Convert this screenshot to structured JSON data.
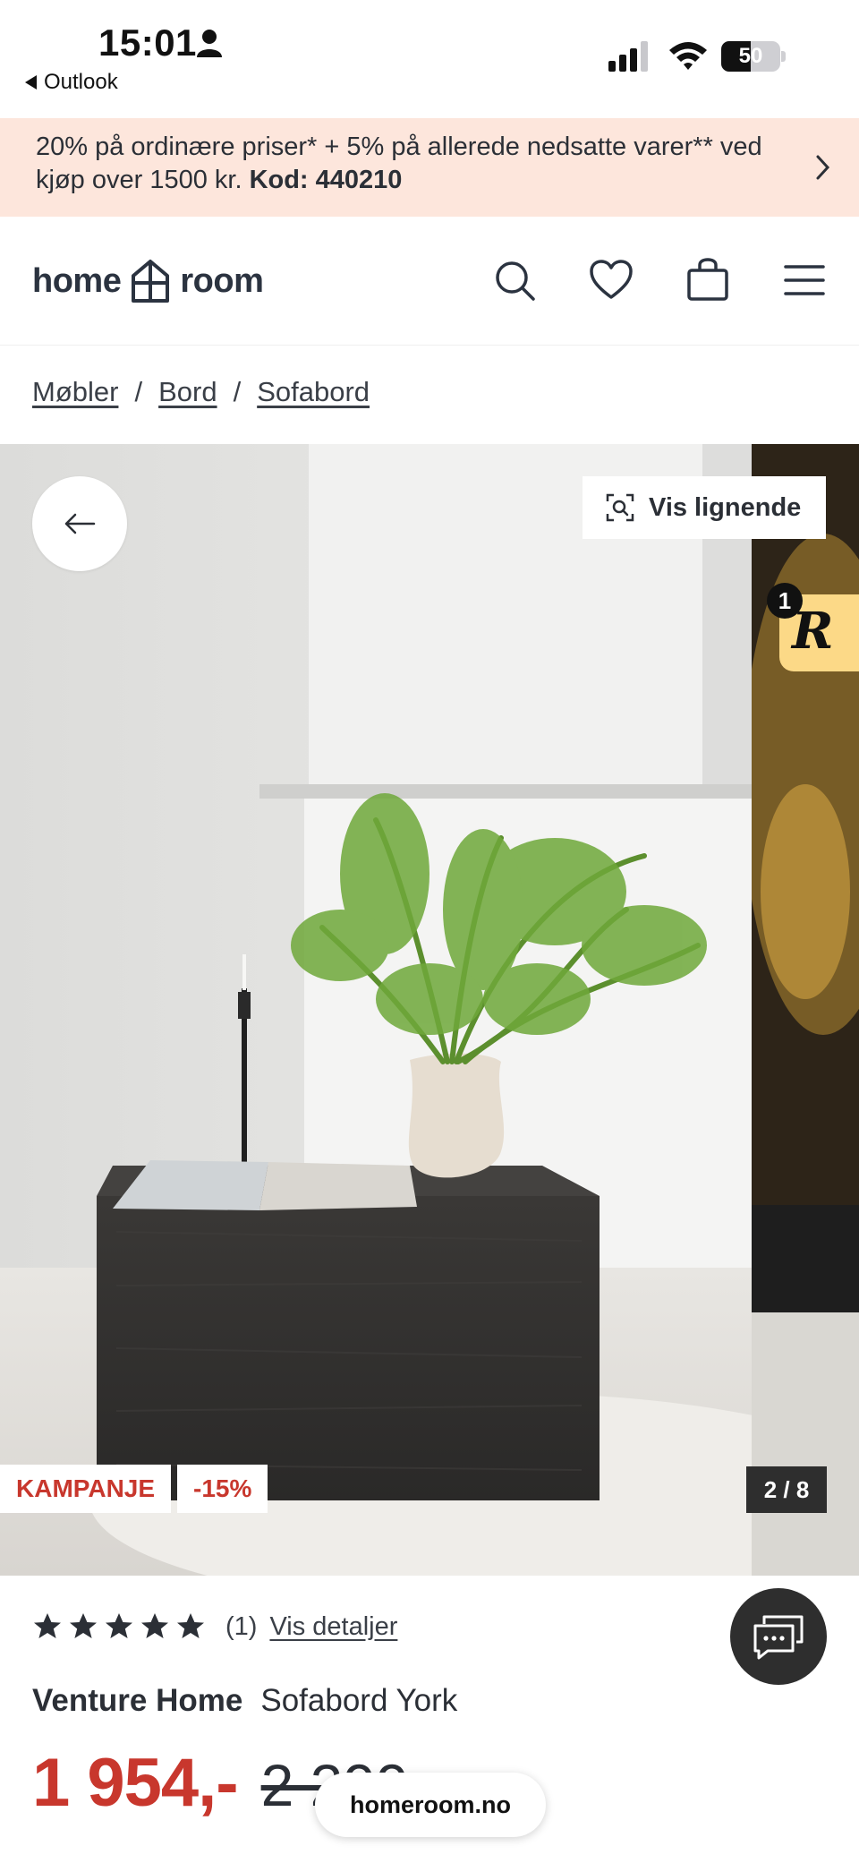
{
  "status_bar": {
    "time": "15:01",
    "back_app": "Outlook",
    "battery_level": "50"
  },
  "promo": {
    "text_line": "20% på ordinære priser* + 5% på allerede nedsatte varer** ved kjøp over 1500 kr.",
    "code": "Kod: 440210"
  },
  "header": {
    "logo_left": "home",
    "logo_right": "room",
    "icons": [
      "search-icon",
      "heart-icon",
      "bag-icon",
      "menu-icon"
    ]
  },
  "breadcrumb": {
    "items": [
      "Møbler",
      "Bord",
      "Sofabord"
    ],
    "separator": "/"
  },
  "gallery": {
    "similar_button": "Vis lignende",
    "reviews_badge_count": "1",
    "reviews_logo": "R",
    "badge_campaign": "KAMPANJE",
    "badge_discount": "-15%",
    "counter": "2 / 8"
  },
  "product": {
    "rating_stars": 5,
    "rating_count": "(1)",
    "rating_link": "Vis detaljer",
    "brand": "Venture Home",
    "name": "Sofabord York",
    "price_now": "1 954,-",
    "price_old": "2 299,-"
  },
  "browser": {
    "url": "homeroom.no"
  },
  "colors": {
    "promo_bg": "#fde6dc",
    "sale_red": "#c8372d",
    "text_dark": "#2b2f36",
    "reviews_yellow": "#fcd987"
  }
}
